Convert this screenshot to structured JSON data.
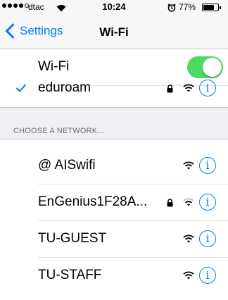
{
  "status_bar": {
    "carrier": "dtac",
    "time": "10:24",
    "battery_percent": "77%",
    "battery_level": 0.77,
    "signal_dots_filled": 4,
    "signal_dots_total": 5
  },
  "nav": {
    "back_label": "Settings",
    "title": "Wi-Fi"
  },
  "wifi_toggle": {
    "label": "Wi-Fi",
    "on": true
  },
  "connected_network": {
    "name": "eduroam",
    "secured": true,
    "selected": true
  },
  "section": {
    "header": "CHOOSE A NETWORK..."
  },
  "networks": [
    {
      "name": "@ AISwifi",
      "secured": false
    },
    {
      "name": "EnGenius1F28A...",
      "secured": true
    },
    {
      "name": "TU-GUEST",
      "secured": false
    },
    {
      "name": "TU-STAFF",
      "secured": false
    }
  ],
  "colors": {
    "accent": "#007aff",
    "toggle_on": "#4cd964",
    "grouped_background": "#efeff4"
  },
  "icons": {
    "back": "chevron-left-icon",
    "check": "checkmark-icon",
    "lock": "lock-icon",
    "wifi": "wifi-signal-icon",
    "info": "info-icon",
    "alarm": "alarm-icon"
  }
}
